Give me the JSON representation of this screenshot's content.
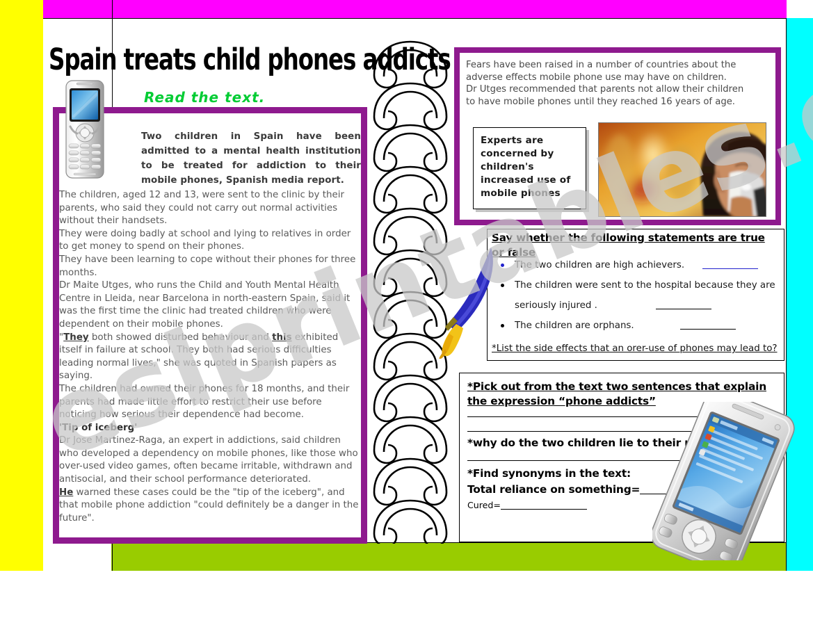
{
  "page": {
    "title": "Spain treats child phones addicts",
    "instruction": "Read the text.",
    "watermark": "eslprintables.com"
  },
  "colors": {
    "band_left": "#ffff00",
    "band_top": "#ff00ff",
    "band_right": "#00ffff",
    "band_bottom": "#99cc00",
    "frame_purple": "#8e1a8e",
    "instruction_green": "#00cc33",
    "body_gray": "#5a5a5a"
  },
  "article": {
    "lead": "Two children in Spain have been admitted to a mental health institution to be treated for addiction to their mobile phones, Spanish media report.",
    "paragraphs": [
      "The children, aged 12 and 13, were sent to the clinic by their parents, who said they could not carry out normal activities without their handsets.",
      "They were doing badly at school and lying to relatives in order to get money to spend on their phones.",
      "They have been learning to cope without their phones for three months.",
      "Dr Maite Utges, who runs the Child and Youth Mental Health Centre in Lleida, near Barcelona in north-eastern Spain, said it was the first time the clinic had treated children who were dependent on their mobile phones."
    ],
    "quote_pre": "\"",
    "quote_word1": "They",
    "quote_mid": " both showed disturbed behaviour and ",
    "quote_word2": "this",
    "quote_post": " exhibited itself in failure at school. They both had serious difficulties leading normal lives,\" she was quoted in Spanish papers as saying.",
    "para_after_quote": "The children had owned their phones for 18 months, and their parents had made little effort to restrict their use before noticing how serious their dependence had become.",
    "subheading": "'Tip of iceberg'",
    "para_expert": "Dr Jose Martinez-Raga, an expert in addictions, said children who developed a dependency on mobile phones, like those who over-used video games, often became irritable, withdrawn and antisocial, and their school performance deteriorated.",
    "final_word": "He",
    "final_rest": " warned these cases could be the \"tip of the iceberg\", and that mobile phone addiction \"could definitely be a danger in the future\"."
  },
  "news": {
    "lines": [
      "Fears have been raised in a number of countries about the",
      "adverse effects mobile phone use may have on children.",
      "Dr Utges recommended that parents not allow their children",
      "to have mobile phones until they reached 16 years of age."
    ],
    "caption": "Experts are concerned by children's increased use of mobile phones",
    "photo_alt": "child-on-mobile-phone-photo"
  },
  "true_false": {
    "heading": "Say whether the following statements are true or false",
    "statements": [
      {
        "text": "The two children are high achievers.",
        "bullet": "blue",
        "blank": true
      },
      {
        "text": "The children were sent to the hospital because they are",
        "text2": "seriously injured  .",
        "bullet": "black",
        "blank": true
      },
      {
        "text": "The children are orphans.",
        "bullet": "black",
        "blank": true
      }
    ],
    "footer": "*List the side effects that an orer-use of phones may lead  to?"
  },
  "questions": {
    "q1_line1": "*Pick out from the text two sentences that explain",
    "q1_line2": "the expression “phone addicts”",
    "q2": "*why do the two children lie to their relatives?",
    "q3_line1": "*Find synonyms in the text:",
    "q3_line2": "Total reliance on something=",
    "q3_line3": "Cured="
  },
  "clipart": {
    "phone": "mobile-phone-illustration",
    "quill": "blue-feather-quill-illustration",
    "pda": "pda-smartphone-illustration",
    "spiral": "spiral-binding-illustration"
  }
}
